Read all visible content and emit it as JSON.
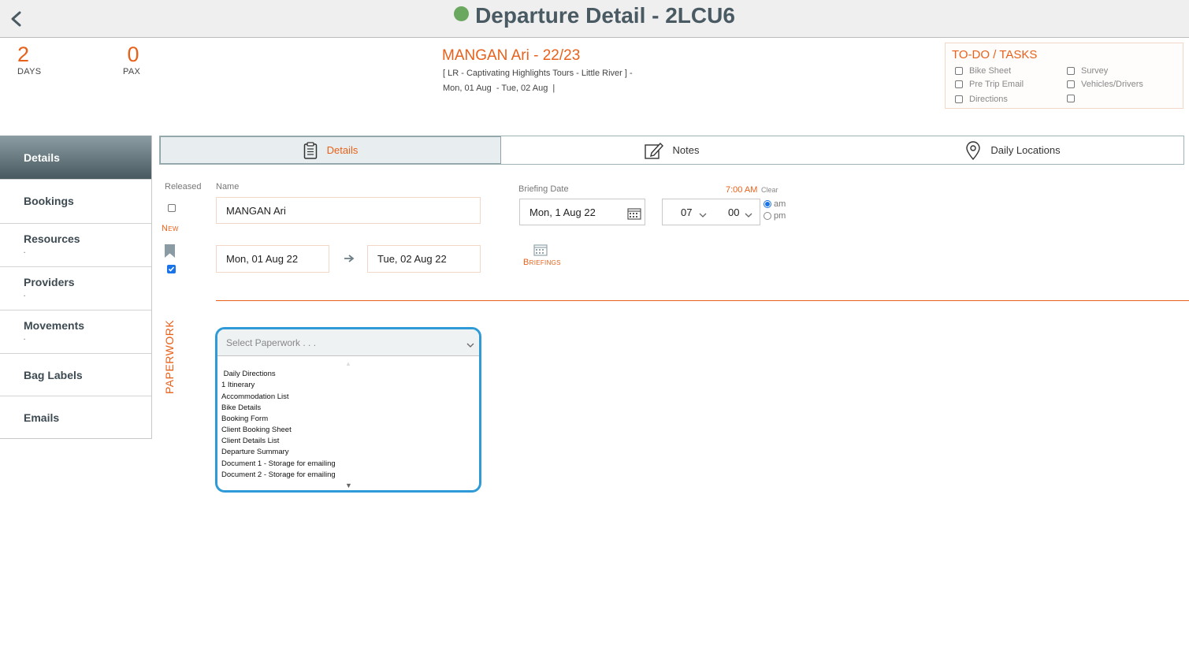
{
  "header": {
    "title": "Departure Detail - 2LCU6",
    "status_color": "#6aa860"
  },
  "stats": {
    "days_value": "2",
    "days_label": "DAYS",
    "pax_value": "0",
    "pax_label": "PAX"
  },
  "client": {
    "name": "MANGAN Ari - 22/23",
    "tour_line": "[ LR - Captivating Highlights Tours - Little River ] -",
    "date_line": "Mon, 01 Aug  - Tue, 02 Aug  |"
  },
  "todo": {
    "title": "TO-DO / TASKS",
    "items_left": [
      "Bike Sheet",
      "Pre Trip Email",
      "Directions"
    ],
    "items_right": [
      "Survey",
      "Vehicles/Drivers",
      ""
    ]
  },
  "sidebar": {
    "items": [
      {
        "label": "Details"
      },
      {
        "label": "Bookings"
      },
      {
        "label": "Resources"
      },
      {
        "label": "Providers"
      },
      {
        "label": "Movements"
      },
      {
        "label": "Bag Labels"
      },
      {
        "label": "Emails"
      }
    ]
  },
  "tabs": [
    {
      "label": "Details",
      "icon": "clipboard-icon"
    },
    {
      "label": "Notes",
      "icon": "pencil-icon"
    },
    {
      "label": "Daily Locations",
      "icon": "location-pin-icon"
    }
  ],
  "form": {
    "released_label": "Released",
    "new_label": "New",
    "name_label": "Name",
    "name_value": "MANGAN Ari",
    "start_date": "Mon, 01 Aug 22",
    "end_date": "Tue, 02 Aug 22",
    "briefing_label": "Briefing Date",
    "briefing_date": "Mon, 1 Aug 22",
    "time_display": "7:00 AM",
    "clear_label": "Clear",
    "hour": "07",
    "minute": "00",
    "am_label": "am",
    "pm_label": "pm",
    "briefings_label": "Briefings",
    "accent_color": "#e8611a"
  },
  "paperwork": {
    "label": "PAPERWORK",
    "placeholder": "Select Paperwork . . .",
    "options": [
      " Daily Directions",
      "1 Itinerary",
      "Accommodation List",
      "Bike Details",
      "Booking Form",
      "Client Booking Sheet",
      "Client Details List",
      "Departure Summary",
      "Document 1 - Storage for emailing",
      "Document 2 - Storage for emailing"
    ]
  }
}
